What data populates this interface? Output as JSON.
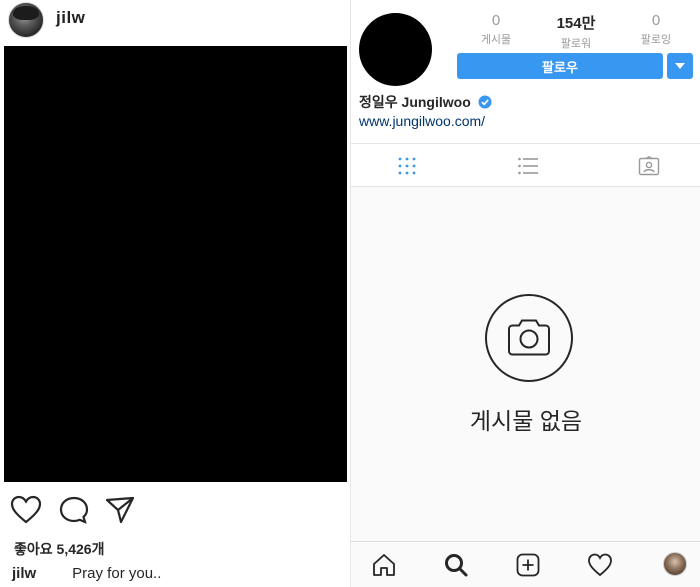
{
  "post": {
    "username": "jilw",
    "likes_text": "좋아요 5,426개",
    "caption_user": "jilw",
    "caption_text": "Pray for you.."
  },
  "profile": {
    "stats": [
      {
        "value": "0",
        "label": "게시물"
      },
      {
        "value": "154만",
        "label": "팔로워"
      },
      {
        "value": "0",
        "label": "팔로잉"
      }
    ],
    "follow_label": "팔로우",
    "display_name": "정일우 Jungilwoo",
    "website": "www.jungilwoo.com/",
    "empty_text": "게시물 없음"
  },
  "icons": {
    "post_actions": [
      "heart-icon",
      "comment-icon",
      "share-icon"
    ],
    "tabs": [
      "grid-icon",
      "list-icon",
      "tagged-icon"
    ],
    "nav": [
      "home-icon",
      "search-icon",
      "add-icon",
      "activity-icon",
      "profile-avatar"
    ]
  },
  "colors": {
    "accent": "#3897f0",
    "link": "#003569",
    "text": "#262626",
    "muted": "#9a9a9a"
  }
}
